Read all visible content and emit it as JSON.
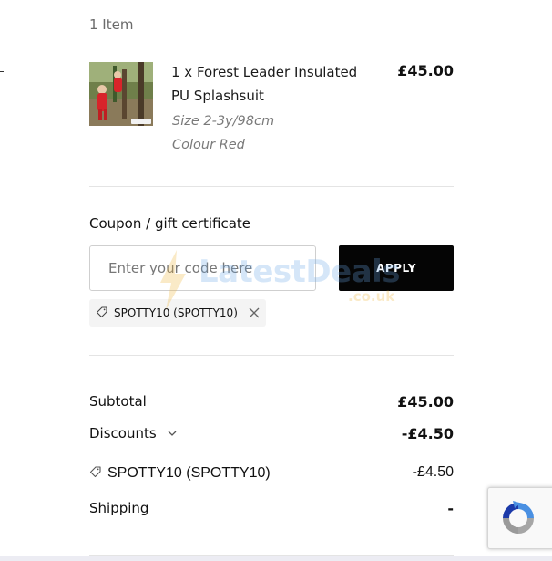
{
  "cart": {
    "item_count": "1 Item"
  },
  "item": {
    "name": "1 x Forest Leader Insulated PU Splashsuit",
    "price": "£45.00",
    "size": "Size 2-3y/98cm",
    "colour": "Colour Red",
    "thumbnail_icon": "product-photo"
  },
  "coupon": {
    "title": "Coupon / gift certificate",
    "placeholder": "Enter your code here",
    "value": "",
    "apply_label": "APPLY",
    "applied_code": "SPOTTY10 (SPOTTY10)"
  },
  "watermark": {
    "text": "LatestDeals",
    "sub": ".co.uk"
  },
  "totals": {
    "subtotal_label": "Subtotal",
    "subtotal_value": "£45.00",
    "discounts_label": "Discounts",
    "discounts_value": "-£4.50",
    "discount_code": "SPOTTY10 (SPOTTY10)",
    "discount_amount": "-£4.50",
    "shipping_label": "Shipping",
    "shipping_value": "-"
  },
  "icons": {
    "tag": "tag-icon",
    "close": "close-icon",
    "chevron": "chevron-down-icon",
    "recaptcha": "recaptcha-icon"
  }
}
